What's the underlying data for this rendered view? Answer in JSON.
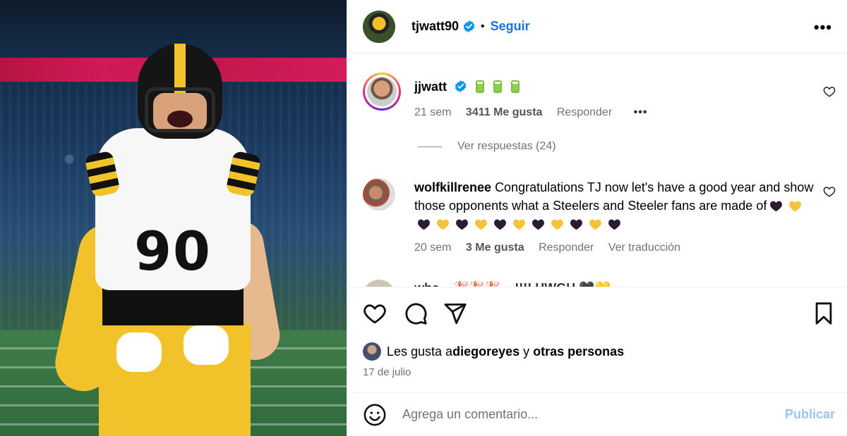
{
  "post": {
    "author": "tjwatt90",
    "follow_label": "Seguir",
    "separator": "•",
    "more_label": "•••",
    "image_alt": "Jugador de los Steelers con el número 90"
  },
  "comments": [
    {
      "user": "jjwatt",
      "verified": true,
      "text": "",
      "badges": [
        "battery-emoji",
        "battery-emoji",
        "battery-emoji"
      ],
      "time": "21 sem",
      "likes": "3411 Me gusta",
      "reply": "Responder",
      "more": "•••"
    },
    {
      "user": "wolfkillrenee",
      "text_start": "Congratulations TJ now let's have a good year and show those opponents what a Steelers and Steeler fans are made of",
      "hearts": [
        "black",
        "yellow",
        "black",
        "yellow",
        "black",
        "yellow",
        "black",
        "yellow",
        "black",
        "yellow",
        "black",
        "yellow",
        "black"
      ],
      "time": "20 sem",
      "likes": "3 Me gusta",
      "reply": "Responder",
      "translate": "Ver traducción"
    },
    {
      "partial_text": "whe... 🎉🎉🎉 ...!!!! HWGH 🖤💛"
    }
  ],
  "replies_label": "Ver respuestas (24)",
  "actions": {
    "like_icon": "heart-icon",
    "comment_icon": "comment-icon",
    "share_icon": "share-icon",
    "save_icon": "bookmark-icon"
  },
  "liked_by": {
    "prefix": "Les gusta a ",
    "user": "diegoreyes",
    "middle": " y ",
    "suffix": "otras personas"
  },
  "date": "17 de julio",
  "composer": {
    "placeholder": "Agrega un comentario...",
    "post_label": "Publicar"
  },
  "colors": {
    "accent": "#1e6fe4",
    "post_disabled": "#9fc2f6",
    "secondary_text": "#737373",
    "steelers_gold": "#f2c22b"
  }
}
